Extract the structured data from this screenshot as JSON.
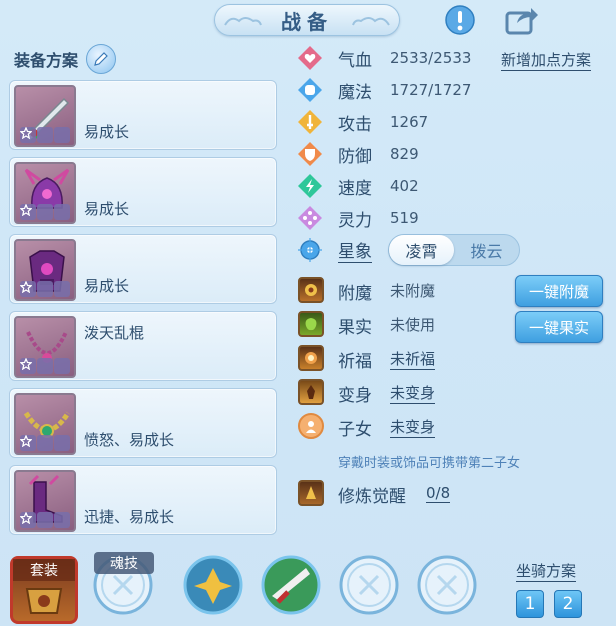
{
  "header": {
    "title": "战备",
    "info_icon": "exclamation-icon",
    "share_icon": "share-icon"
  },
  "plan": {
    "title": "装备方案",
    "edit_icon": "pencil-icon"
  },
  "equipment": [
    {
      "name": "weapon",
      "text": "易成长"
    },
    {
      "name": "helmet",
      "text": "易成长"
    },
    {
      "name": "armor",
      "text": "易成长"
    },
    {
      "name": "necklace",
      "text": "泼天乱棍"
    },
    {
      "name": "belt",
      "text": "愤怒、易成长"
    },
    {
      "name": "boots",
      "text": "迅捷、易成长"
    }
  ],
  "stats": [
    {
      "label": "气血",
      "value": "2533/2533",
      "icon": "heart-icon",
      "color": "#e46a8a"
    },
    {
      "label": "魔法",
      "value": "1727/1727",
      "icon": "mana-icon",
      "color": "#4aa6ea"
    },
    {
      "label": "攻击",
      "value": "1267",
      "icon": "attack-icon",
      "color": "#f0b43a"
    },
    {
      "label": "防御",
      "value": "829",
      "icon": "shield-icon",
      "color": "#f08a4a"
    },
    {
      "label": "速度",
      "value": "402",
      "icon": "speed-icon",
      "color": "#2ec79a"
    },
    {
      "label": "灵力",
      "value": "519",
      "icon": "spirit-icon",
      "color": "#c98ae0"
    }
  ],
  "add_points": "新增加点方案",
  "star": {
    "label": "星象",
    "options": [
      "凌霄",
      "拨云"
    ],
    "active": 0
  },
  "actions": [
    {
      "label": "附魔",
      "value": "未附魔",
      "icon": "enchant-icon",
      "underline": false
    },
    {
      "label": "果实",
      "value": "未使用",
      "icon": "fruit-icon",
      "underline": false
    },
    {
      "label": "祈福",
      "value": "未祈福",
      "icon": "pray-icon",
      "underline": true
    },
    {
      "label": "变身",
      "value": "未变身",
      "icon": "transform-icon",
      "underline": true
    },
    {
      "label": "子女",
      "value": "未变身",
      "icon": "child-icon",
      "underline": true
    }
  ],
  "buttons": {
    "enchant_all": "一键附魔",
    "fruit_all": "一键果实"
  },
  "hint": "穿戴时装或饰品可携带第二子女",
  "cultivate": {
    "label": "修炼觉醒",
    "value": "0/8"
  },
  "bottom": {
    "suit": "套装",
    "soul": "魂技",
    "mount_title": "坐骑方案",
    "mount_options": [
      "1",
      "2"
    ]
  },
  "colors": {
    "accent": "#3f9fe0",
    "text": "#2e4e6e",
    "hint": "#4f82b8"
  }
}
